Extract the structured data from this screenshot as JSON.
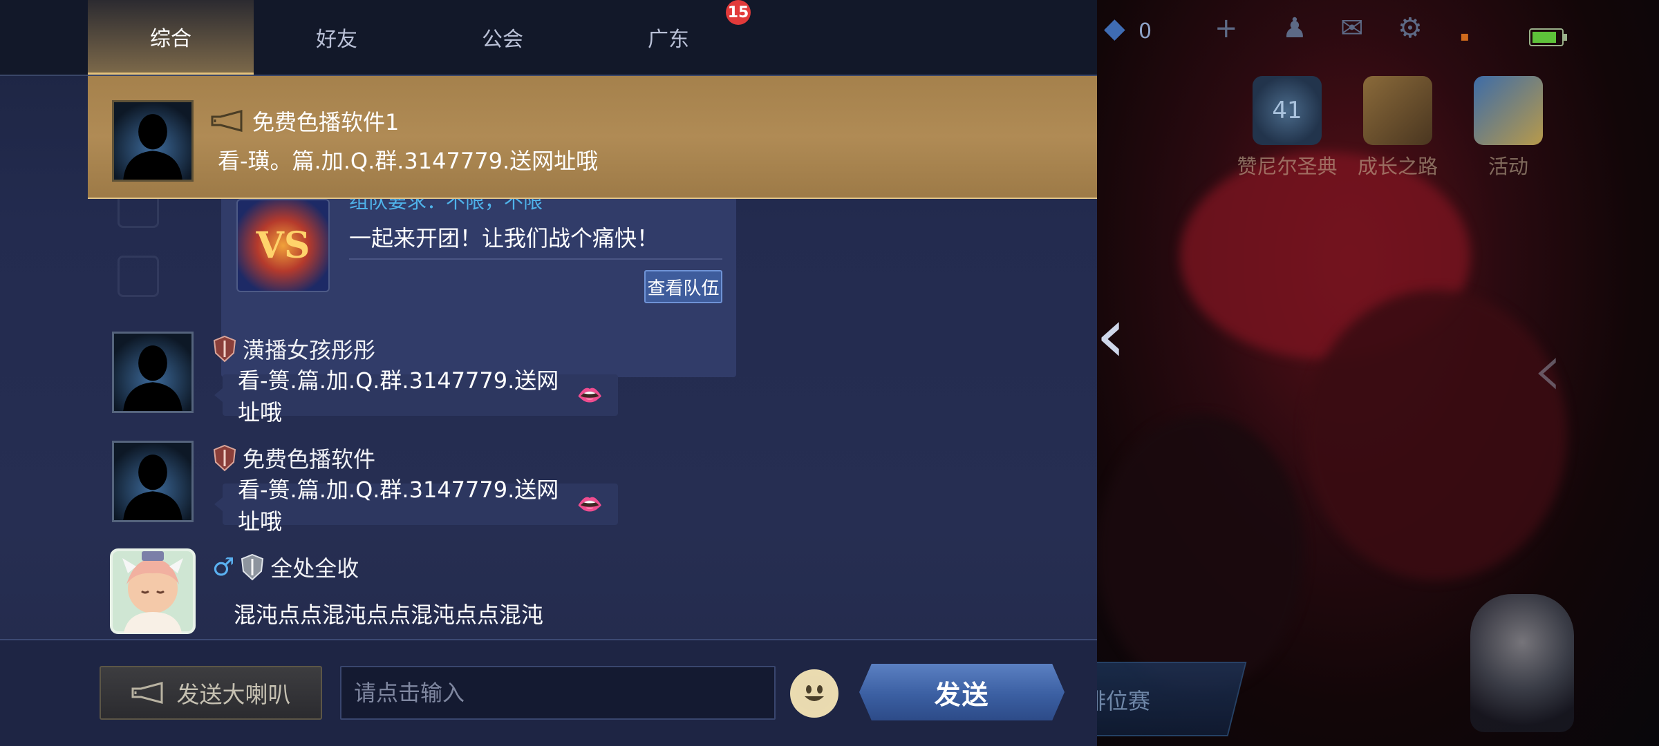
{
  "tabs": [
    {
      "label": "综合",
      "active": true
    },
    {
      "label": "好友",
      "active": false
    },
    {
      "label": "公会",
      "active": false
    },
    {
      "label": "广东",
      "active": false
    }
  ],
  "tab_badge": "15",
  "banner": {
    "sender": "免费色播软件1",
    "message": "看-璜。篇.加.Q.群.3147779.送网址哦"
  },
  "team_card": {
    "requirement": "组队要求：不限，不限",
    "slogan": "一起来开团！让我们战个痛快！",
    "view_button": "查看队伍",
    "vs_text": "VS"
  },
  "messages": [
    {
      "sender": "潢播女孩彤彤",
      "text": "看-篑.篇.加.Q.群.3147779.送网址哦"
    },
    {
      "sender": "免费色播软件",
      "text": "看-篑.篇.加.Q.群.3147779.送网址哦"
    },
    {
      "sender": "全处全收",
      "gender": "♂",
      "text": "混沌点点混沌点点混沌点点混沌"
    }
  ],
  "input_bar": {
    "horn_button": "发送大喇叭",
    "placeholder": "请点击输入",
    "send_button": "发送"
  },
  "background": {
    "topbar_value": "0",
    "features": [
      {
        "label": "赞尼尔圣典",
        "level": "41"
      },
      {
        "label": "成长之路"
      },
      {
        "label": "活动"
      }
    ],
    "rank_match": "排位赛"
  },
  "colors": {
    "banner_gold": "#b08b55",
    "tab_active": "#e5c27b",
    "send_blue": "#3b5fa2",
    "badge_red": "#e23a3a"
  }
}
